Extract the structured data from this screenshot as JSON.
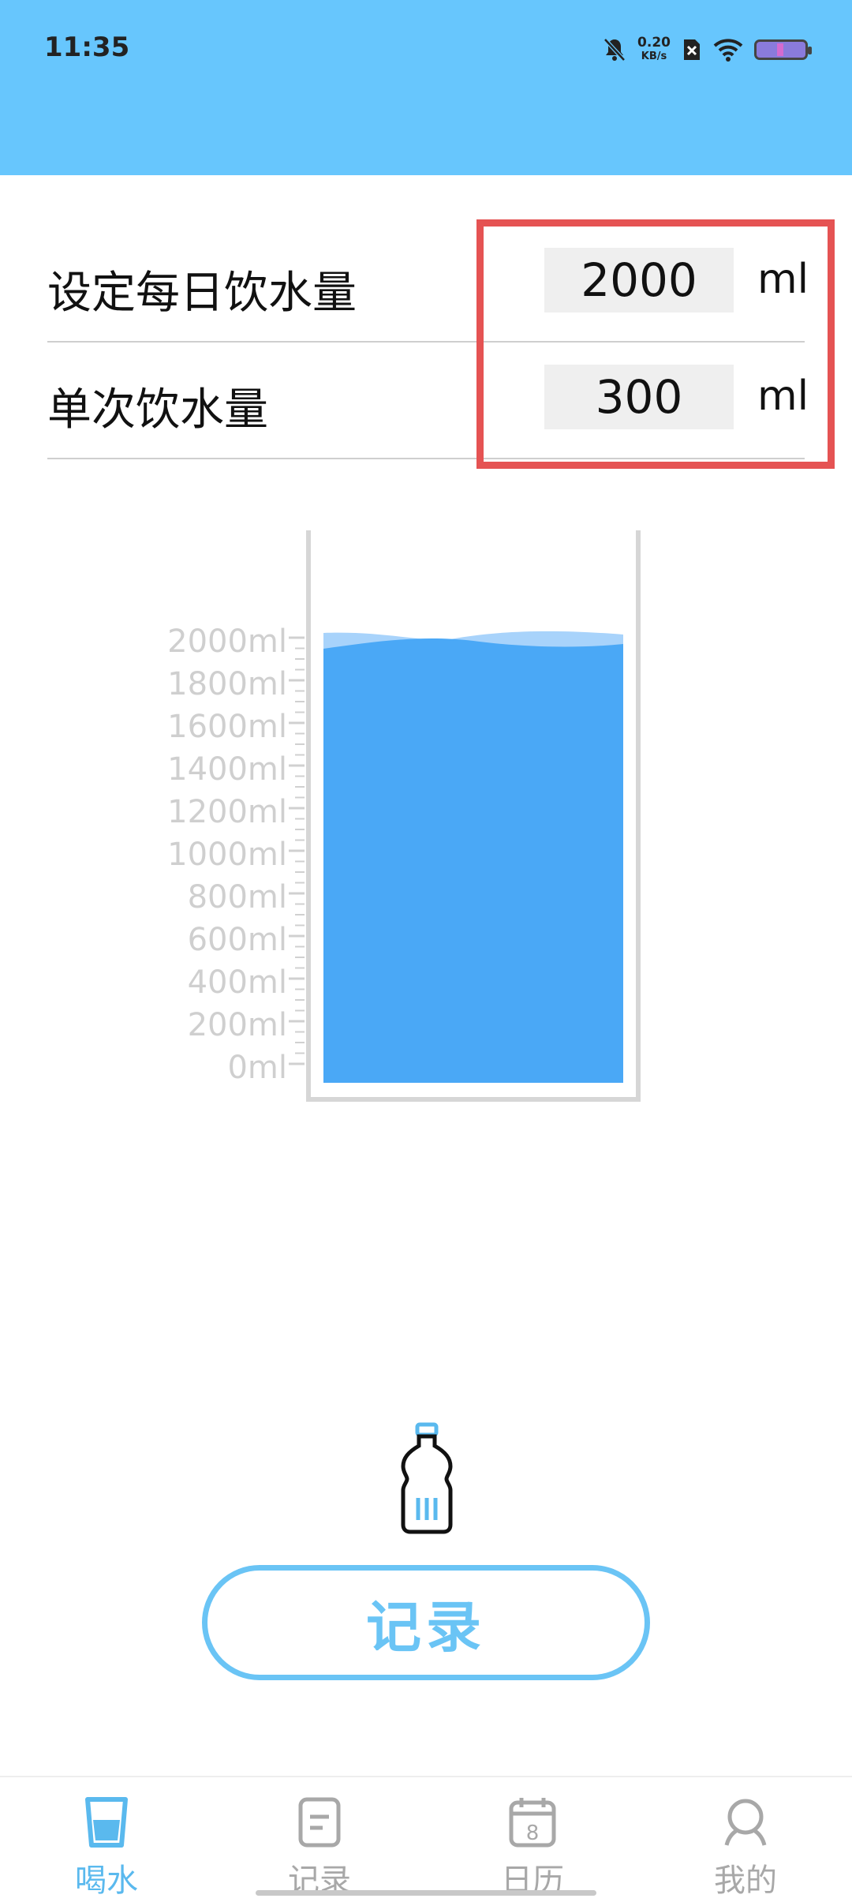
{
  "status": {
    "time": "11:35",
    "net_speed": "0.20",
    "net_unit": "KB/s"
  },
  "settings": {
    "daily_label": "设定每日饮水量",
    "daily_value": "2000",
    "single_label": "单次饮水量",
    "single_value": "300",
    "unit": "ml"
  },
  "glass": {
    "scale": [
      "2000ml",
      "1800ml",
      "1600ml",
      "1400ml",
      "1200ml",
      "1000ml",
      "800ml",
      "600ml",
      "400ml",
      "200ml",
      "0ml"
    ],
    "fill_level_ml": 2000,
    "max_ml": 2000
  },
  "record_button": "记录",
  "nav": [
    {
      "label": "喝水",
      "icon": "cup-icon",
      "active": true
    },
    {
      "label": "记录",
      "icon": "document-icon",
      "active": false
    },
    {
      "label": "日历",
      "icon": "calendar-icon",
      "active": false
    },
    {
      "label": "我的",
      "icon": "profile-icon",
      "active": false
    }
  ],
  "calendar_day": "8",
  "colors": {
    "header": "#67c6fd",
    "water": "#4aa8f6",
    "accent": "#5ab9ee",
    "highlight": "#e55353"
  }
}
